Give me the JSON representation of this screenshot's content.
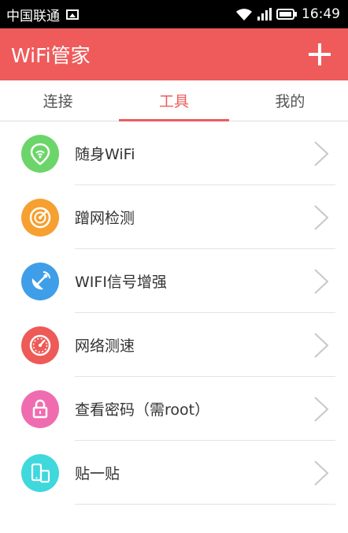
{
  "status_bar": {
    "carrier": "中国联通",
    "time": "16:49"
  },
  "app_bar": {
    "title": "WiFi管家"
  },
  "tabs": [
    {
      "label": "连接"
    },
    {
      "label": "工具"
    },
    {
      "label": "我的"
    }
  ],
  "tools": [
    {
      "label": "随身WiFi",
      "icon": "portable-wifi-icon",
      "color": "#6cd56a"
    },
    {
      "label": "蹭网检测",
      "icon": "radar-scan-icon",
      "color": "#f5a030"
    },
    {
      "label": "WIFI信号增强",
      "icon": "satellite-dish-icon",
      "color": "#3f9ee8"
    },
    {
      "label": "网络测速",
      "icon": "speedometer-icon",
      "color": "#ee5a57"
    },
    {
      "label": "查看密码（需root）",
      "icon": "lock-icon",
      "color": "#f06cb0"
    },
    {
      "label": "贴一贴",
      "icon": "phone-transfer-icon",
      "color": "#3fd8dc"
    }
  ],
  "colors": {
    "accent": "#ef5b5b",
    "divider": "#e3e3e3"
  }
}
